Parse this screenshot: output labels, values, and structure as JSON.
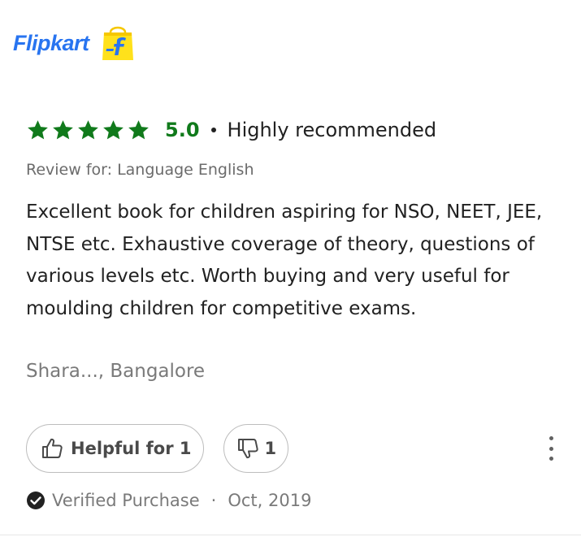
{
  "header": {
    "logo_text": "Flipkart",
    "logo_icon": "shopping-bag-icon"
  },
  "review": {
    "rating_value": 5,
    "rating_text": "5.0",
    "headline": "Highly recommended",
    "review_for_label": "Review for:",
    "review_for_value": "Language English",
    "body": "Excellent book for children aspiring for NSO, NEET, JEE, NTSE etc. Exhaustive coverage of theory, questions of various levels etc. Worth buying and very useful for moulding children for competitive exams.",
    "reviewer": "Shara..., Bangalore",
    "helpful_label": "Helpful for 1",
    "dislike_count": "1",
    "verified_label": "Verified Purchase",
    "separator": "·",
    "date": "Oct, 2019"
  },
  "colors": {
    "brand_blue": "#2874f0",
    "brand_yellow": "#ffe11b",
    "rating_green": "#107a1b"
  }
}
